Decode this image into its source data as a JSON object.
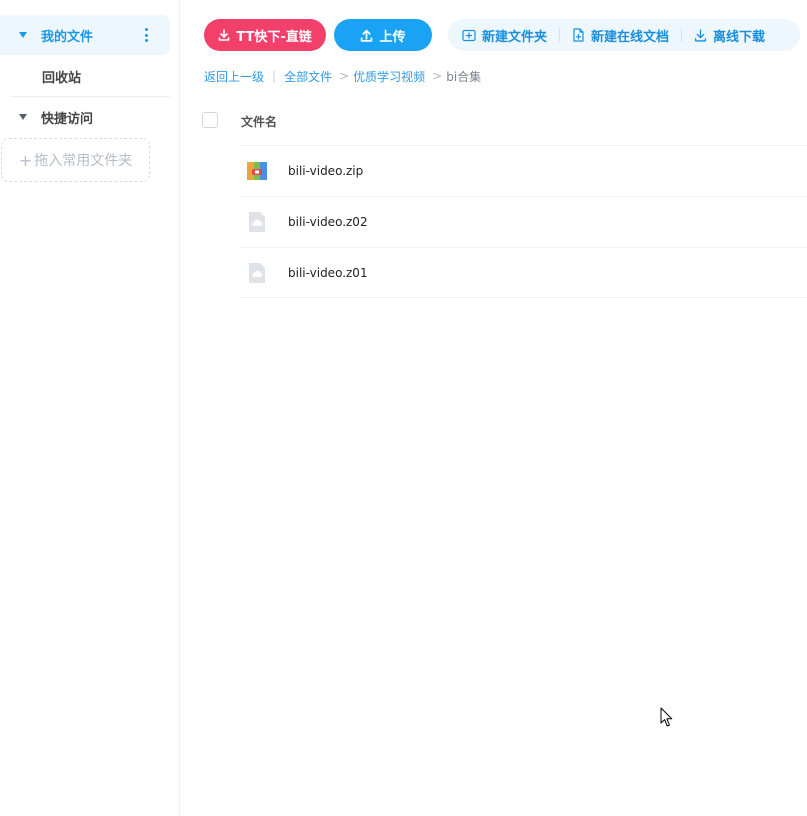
{
  "sidebar": {
    "my_files": "我的文件",
    "recycle": "回收站",
    "quick_access": "快捷访问",
    "drop_hint": "拖入常用文件夹"
  },
  "toolbar": {
    "tt_download": "TT快下-直链",
    "upload": "上传",
    "new_folder": "新建文件夹",
    "new_online_doc": "新建在线文档",
    "offline_download": "离线下载"
  },
  "breadcrumb": {
    "back": "返回上一级",
    "all_files": "全部文件",
    "folder": "优质学习视频",
    "current": "bi合集"
  },
  "list": {
    "column_name": "文件名",
    "files": [
      {
        "name": "bili-video.zip",
        "icon": "zip-archive-icon"
      },
      {
        "name": "bili-video.z02",
        "icon": "generic-file-icon"
      },
      {
        "name": "bili-video.z01",
        "icon": "generic-file-icon"
      }
    ]
  },
  "colors": {
    "accent": "#1a9ae8",
    "tt_button": "#f2406a",
    "upload_button": "#1aa3f5"
  }
}
